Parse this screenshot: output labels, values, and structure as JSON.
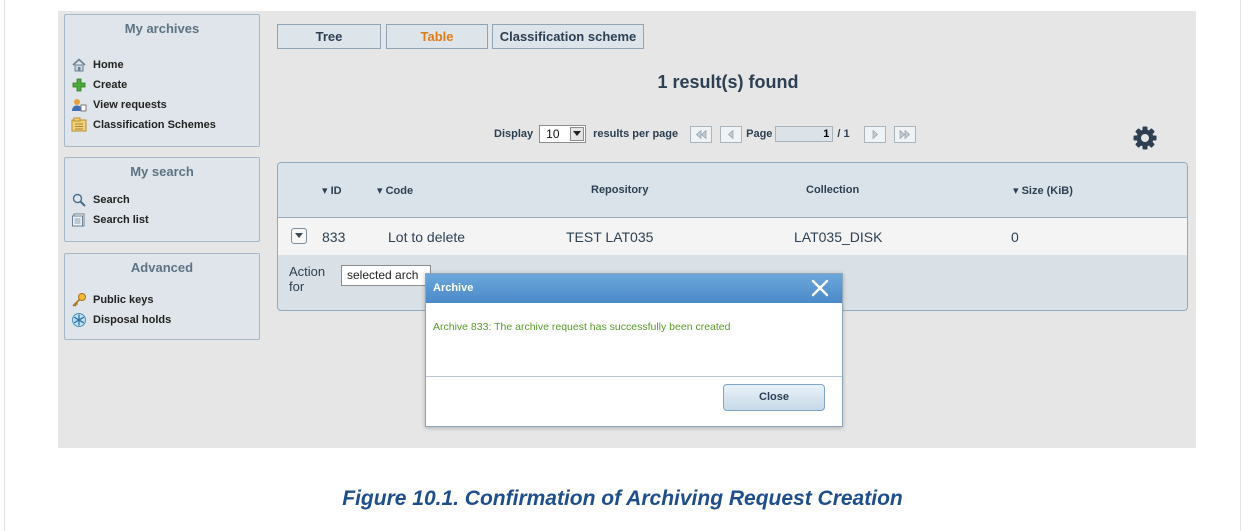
{
  "sidebar": {
    "archives": {
      "title": "My archives",
      "items": [
        {
          "label": "Home",
          "icon": "home-icon"
        },
        {
          "label": "Create",
          "icon": "plus-icon"
        },
        {
          "label": "View requests",
          "icon": "user-request-icon"
        },
        {
          "label": "Classification Schemes",
          "icon": "folder-tree-icon"
        }
      ]
    },
    "search": {
      "title": "My search",
      "items": [
        {
          "label": "Search",
          "icon": "magnifier-icon"
        },
        {
          "label": "Search list",
          "icon": "list-icon"
        }
      ]
    },
    "advanced": {
      "title": "Advanced",
      "items": [
        {
          "label": "Public keys",
          "icon": "key-icon"
        },
        {
          "label": "Disposal holds",
          "icon": "snowflake-icon"
        }
      ]
    }
  },
  "tabs": [
    {
      "label": "Tree",
      "active": false
    },
    {
      "label": "Table",
      "active": true
    },
    {
      "label": "Classification scheme",
      "active": false
    }
  ],
  "results": {
    "text": "1 result(s) found"
  },
  "pager": {
    "display_label": "Display",
    "per_page": "10",
    "per_page_suffix": "results per page",
    "page_label": "Page",
    "current_page": "1",
    "total_pages": "/ 1"
  },
  "table": {
    "columns": [
      "ID",
      "Code",
      "Repository",
      "Collection",
      "Size (KiB)"
    ],
    "rows": [
      {
        "id": "833",
        "code": "Lot to delete",
        "repository": "TEST LAT035",
        "collection": "LAT035_DISK",
        "size": "0"
      }
    ]
  },
  "action": {
    "label_line1": "Action",
    "label_line2": "for",
    "select_value": "selected arch"
  },
  "dialog": {
    "title": "Archive",
    "message": "Archive 833: The archive request has successfully been created",
    "button": "Close"
  },
  "caption": "Figure 10.1. Confirmation of Archiving Request Creation",
  "colors": {
    "accent_orange": "#e07b1a",
    "success_green": "#5a9a2a",
    "caption_blue": "#1f4e8c",
    "dialog_bar": "#5b97d1"
  }
}
